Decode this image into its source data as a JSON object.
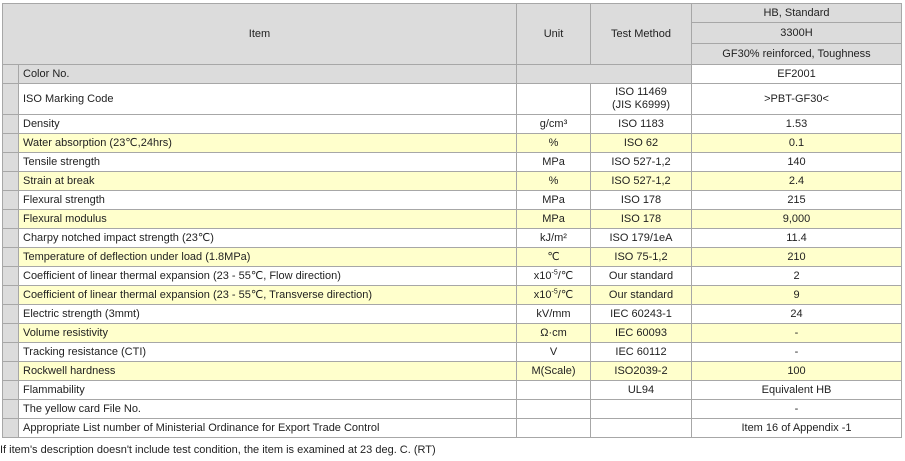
{
  "header": {
    "item": "Item",
    "unit": "Unit",
    "test_method": "Test Method",
    "grade_standard": "HB, Standard",
    "grade_name": "3300H",
    "grade_desc": "GF30% reinforced, Toughness"
  },
  "rows": [
    {
      "item": "Color No.",
      "unit": "",
      "method": "",
      "value": "EF2001",
      "highlight": false
    },
    {
      "item": "ISO Marking Code",
      "unit": "",
      "method": "ISO 11469",
      "method2": "(JIS K6999)",
      "value": ">PBT-GF30<",
      "highlight": false
    },
    {
      "item": "Density",
      "unit": "g/cm³",
      "method": "ISO 1183",
      "value": "1.53",
      "highlight": false
    },
    {
      "item": "Water absorption (23℃,24hrs)",
      "unit": "%",
      "method": "ISO 62",
      "value": "0.1",
      "highlight": true
    },
    {
      "item": "Tensile strength",
      "unit": "MPa",
      "method": "ISO 527-1,2",
      "value": "140",
      "highlight": false
    },
    {
      "item": "Strain at break",
      "unit": "%",
      "method": "ISO 527-1,2",
      "value": "2.4",
      "highlight": true
    },
    {
      "item": "Flexural strength",
      "unit": "MPa",
      "method": "ISO 178",
      "value": "215",
      "highlight": false
    },
    {
      "item": "Flexural modulus",
      "unit": "MPa",
      "method": "ISO 178",
      "value": "9,000",
      "highlight": true
    },
    {
      "item": "Charpy notched impact strength (23℃)",
      "unit": "kJ/m²",
      "method": "ISO 179/1eA",
      "value": "11.4",
      "highlight": false
    },
    {
      "item": "Temperature of deflection under load (1.8MPa)",
      "unit": "℃",
      "method": "ISO 75-1,2",
      "value": "210",
      "highlight": true
    },
    {
      "item": "Coefficient of linear thermal expansion (23 - 55℃, Flow direction)",
      "unit_base": "x10",
      "unit_exp": "-5",
      "unit_tail": "/℃",
      "method": "Our standard",
      "value": "2",
      "highlight": false
    },
    {
      "item": "Coefficient of linear thermal expansion (23 - 55℃, Transverse direction)",
      "unit_base": "x10",
      "unit_exp": "-5",
      "unit_tail": "/℃",
      "method": "Our standard",
      "value": "9",
      "highlight": true
    },
    {
      "item": "Electric strength (3mmt)",
      "unit": "kV/mm",
      "method": "IEC 60243-1",
      "value": "24",
      "highlight": false
    },
    {
      "item": "Volume resistivity",
      "unit": "Ω·cm",
      "method": "IEC 60093",
      "value": "-",
      "highlight": true
    },
    {
      "item": "Tracking resistance (CTI)",
      "unit": "V",
      "method": "IEC 60112",
      "value": "-",
      "highlight": false
    },
    {
      "item": "Rockwell hardness",
      "unit": "M(Scale)",
      "method": "ISO2039-2",
      "value": "100",
      "highlight": true
    },
    {
      "item": "Flammability",
      "unit": "",
      "method": "UL94",
      "value": "Equivalent HB",
      "highlight": false
    },
    {
      "item": "The yellow card File No.",
      "unit": "",
      "method": "",
      "value": "-",
      "highlight": false
    },
    {
      "item": "Appropriate List number of Ministerial Ordinance for Export Trade Control",
      "unit": "",
      "method": "",
      "value": "Item 16 of Appendix -1",
      "highlight": false
    }
  ],
  "footnote": "If item's description doesn't include test condition, the item is examined at 23 deg. C. (RT)"
}
